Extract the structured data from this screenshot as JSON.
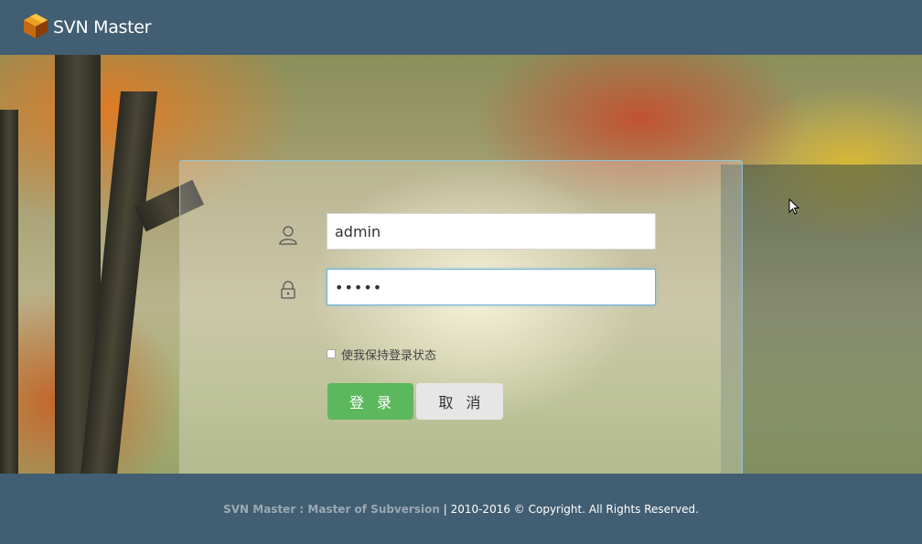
{
  "header": {
    "logo_icon": "svn-cube-icon",
    "title": "SVN Master"
  },
  "login": {
    "username_icon": "user-icon",
    "username_value": "admin",
    "password_icon": "lock-icon",
    "password_value": "•••••",
    "remember_label": "使我保持登录状态",
    "login_button": "登录",
    "cancel_button": "取消"
  },
  "footer": {
    "brand": "SVN Master : Master of Subversion",
    "separator": " | ",
    "copyright": "2010-2016 © Copyright. All Rights Reserved."
  },
  "colors": {
    "header_bg": "#415e72",
    "login_button_bg": "#5cb85c",
    "cancel_button_bg": "#e6e6e6",
    "panel_border": "#8cc8e1"
  }
}
